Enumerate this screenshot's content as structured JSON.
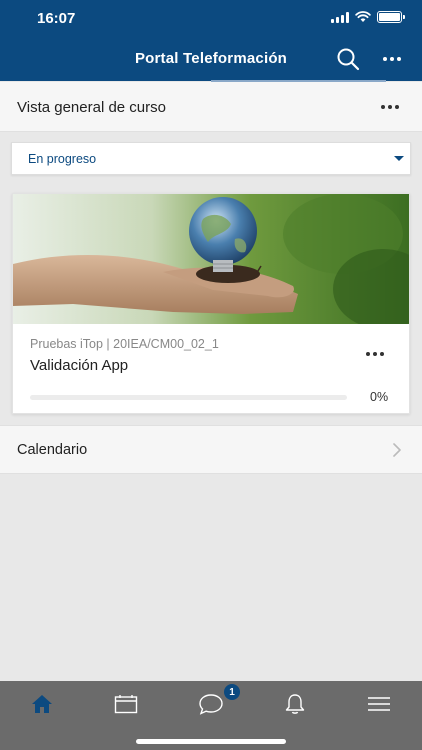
{
  "status_bar": {
    "time": "16:07"
  },
  "header": {
    "title": "Portal Teleformación",
    "search_icon": "search-icon",
    "more_icon": "more-horizontal-icon"
  },
  "section": {
    "title": "Vista general de curso",
    "more_icon": "more-horizontal-icon"
  },
  "filter": {
    "selected": "En progreso",
    "icon": "caret-down-icon"
  },
  "course_card": {
    "category": "Pruebas iTop | 20IEA/CM00_02_1",
    "title": "Validación App",
    "progress_label": "0%",
    "progress_value": 0,
    "image": "lightbulb-earth-in-hands"
  },
  "calendar_row": {
    "label": "Calendario",
    "icon": "chevron-right-icon"
  },
  "tabbar": {
    "tabs": [
      {
        "name": "home",
        "icon": "home-icon",
        "active": true
      },
      {
        "name": "calendar",
        "icon": "calendar-icon",
        "active": false
      },
      {
        "name": "messages",
        "icon": "chat-icon",
        "active": false,
        "badge": "1"
      },
      {
        "name": "notifications",
        "icon": "bell-icon",
        "active": false
      },
      {
        "name": "menu",
        "icon": "menu-icon",
        "active": false
      }
    ]
  },
  "colors": {
    "brand": "#0c4a80",
    "active_tab": "#0c4a80",
    "inactive_tab": "#ffffff",
    "tabbar_bg": "#6b6b6b"
  }
}
